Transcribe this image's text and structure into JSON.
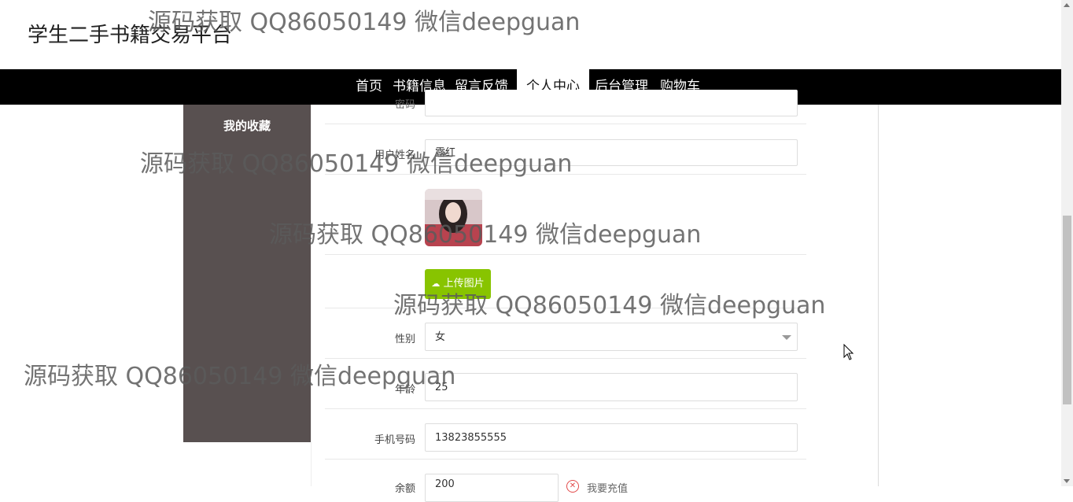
{
  "site": {
    "title": "学生二手书籍交易平台"
  },
  "nav": {
    "items": [
      {
        "label": "首页"
      },
      {
        "label": "书籍信息"
      },
      {
        "label": "留言反馈"
      },
      {
        "label": "个人中心",
        "active": true
      },
      {
        "label": "后台管理"
      },
      {
        "label": "购物车"
      }
    ]
  },
  "sidebar": {
    "items": [
      {
        "label": "我的收藏"
      }
    ]
  },
  "form": {
    "top_label": "密码",
    "name_label": "用户姓名",
    "name_value": "露红",
    "upload_label": "上传图片",
    "gender_label": "性别",
    "gender_value": "女",
    "age_label": "年龄",
    "age_value": "25",
    "phone_label": "手机号码",
    "phone_value": "13823855555",
    "balance_label": "余额",
    "balance_value": "200",
    "recharge_label": "我要充值"
  },
  "watermark": {
    "text": "源码获取 QQ86050149 微信deepguan"
  },
  "colors": {
    "nav_bg": "#000000",
    "sidebar_bg": "#585050",
    "upload_button": "#88c400",
    "recharge_icon": "#e24b4b"
  }
}
